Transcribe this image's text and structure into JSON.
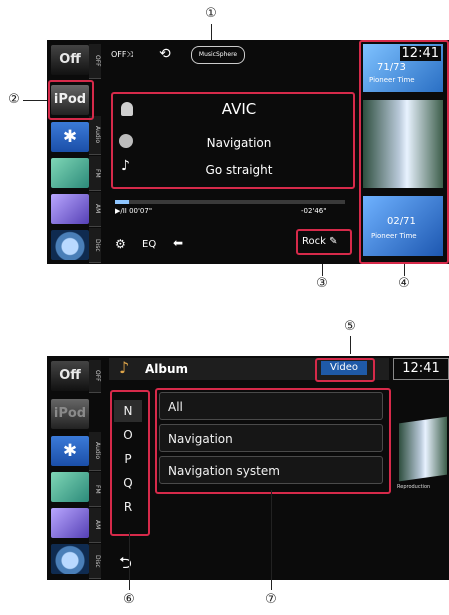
{
  "callouts": {
    "c1": "①",
    "c2": "②",
    "c3": "③",
    "c4": "④",
    "c5": "⑤",
    "c6": "⑥",
    "c7": "⑦"
  },
  "sidebar": {
    "off_label": "Off",
    "ipod_label": "iPod",
    "strip_labels": [
      "OFF",
      "Audio",
      "FM",
      "AM",
      "Disc"
    ],
    "bluetooth_symbol": "✱"
  },
  "top": {
    "status": {
      "shuffle": "OFF⤨",
      "repeat": "⟲",
      "musicsphere": "MusicSphere",
      "clock": "12:41"
    },
    "track": {
      "title": "AVIC",
      "album": "Navigation",
      "artist": "Go straight"
    },
    "progress": {
      "elapsed": "▶/II 00'07\"",
      "remaining": "-02'46\"",
      "fraction": 0.06
    },
    "bottom_bar": {
      "settings_icon": "gear-icon",
      "eq_label": "EQ",
      "back_icon": "return-icon",
      "genre": "Rock"
    },
    "thumbs": {
      "t1_line1": "71/73",
      "t1_line2": "Pioneer Time",
      "t3_line1": "02/71",
      "t3_line2": "Pioneer Time"
    }
  },
  "bottom": {
    "header": {
      "title": "Album",
      "video_button": "Video",
      "clock": "12:41"
    },
    "alpha": [
      "N",
      "O",
      "P",
      "Q",
      "R"
    ],
    "list": [
      "All",
      "Navigation",
      "Navigation system"
    ],
    "back_symbol": "⮌",
    "thumb_caption": "Reproduction"
  }
}
